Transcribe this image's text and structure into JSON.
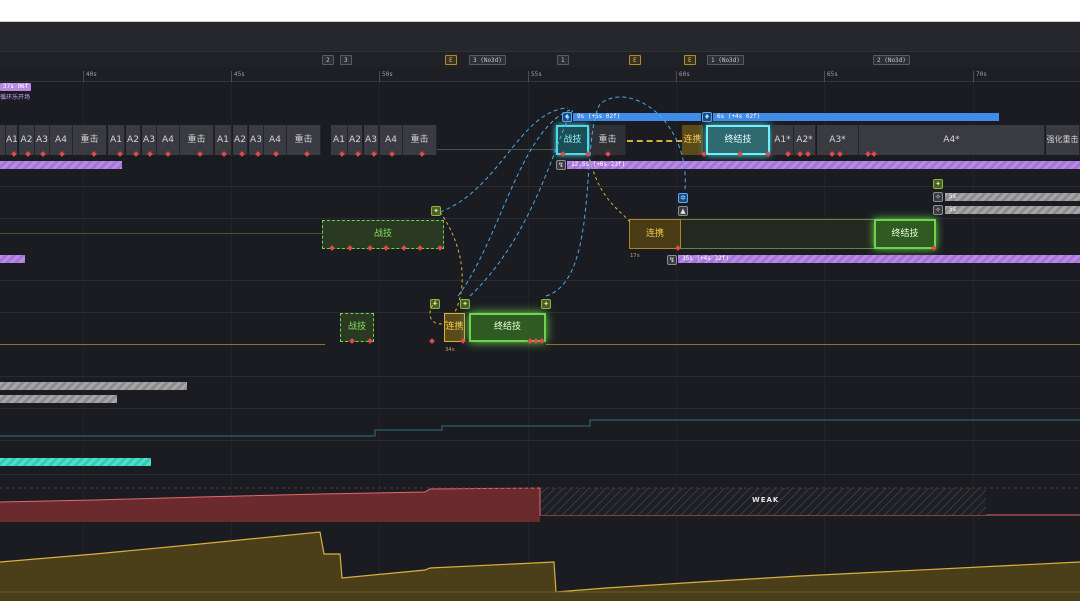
{
  "ruler": {
    "ticks": [
      "40s",
      "45s",
      "50s",
      "55s",
      "60s",
      "65s",
      "70s"
    ]
  },
  "markers": [
    {
      "text": "2",
      "style": "plain"
    },
    {
      "text": "3",
      "style": "plain"
    },
    {
      "text": "E",
      "style": "gold"
    },
    {
      "text": "3 (No3d)",
      "style": "plain"
    },
    {
      "text": "1",
      "style": "plain"
    },
    {
      "text": "E",
      "style": "gold"
    },
    {
      "text": "E",
      "style": "gold"
    },
    {
      "text": "1 (No3d)",
      "style": "plain"
    },
    {
      "text": "2 (No3d)",
      "style": "plain"
    }
  ],
  "top_left": {
    "timer_badge": "37s 06f",
    "label": "循环乐开场"
  },
  "row1": {
    "chips": [
      {
        "text": "A1"
      },
      {
        "text": "A2"
      },
      {
        "text": "A3"
      },
      {
        "text": "A4"
      },
      {
        "text": "重击"
      },
      {
        "text": "A1"
      },
      {
        "text": "A2"
      },
      {
        "text": "A3"
      },
      {
        "text": "A4"
      },
      {
        "text": "重击"
      },
      {
        "text": "A1"
      },
      {
        "text": "A2"
      },
      {
        "text": "A3"
      },
      {
        "text": "A4"
      },
      {
        "text": "重击"
      },
      {
        "text": "A1"
      },
      {
        "text": "A2"
      },
      {
        "text": "A3"
      },
      {
        "text": "A4"
      },
      {
        "text": "重击"
      }
    ],
    "skill": "战技",
    "heavy": "重击",
    "combo": "连携",
    "ultimate": "终结技",
    "tail_chips": [
      "A1*",
      "A2*",
      "A3*",
      "A4*",
      "强化重击"
    ],
    "buff_blue_1": "9s (+5s 02f)",
    "buff_blue_2": "6s (+4s 02f)",
    "purple_small": "12.5s (+6s 23f)"
  },
  "row2": {
    "skill": "战技",
    "combo": "连携",
    "ultimate": "终结技",
    "combo_time": "17s",
    "purple_bar": "35s (+4s 32f)",
    "gray_bar_1": "5s",
    "gray_bar_2": "5s"
  },
  "row3": {
    "skill": "战技",
    "combo": "连携",
    "ultimate": "终结技",
    "combo_time": "34s"
  },
  "weak_label": "WEAK",
  "colors": {
    "accent_cyan": "#4fd8e8",
    "accent_green": "#6bd64a",
    "accent_gold": "#d8b040",
    "accent_purple": "#b88ae6",
    "accent_blue": "#3f8de8",
    "danger": "#e04a4a"
  }
}
